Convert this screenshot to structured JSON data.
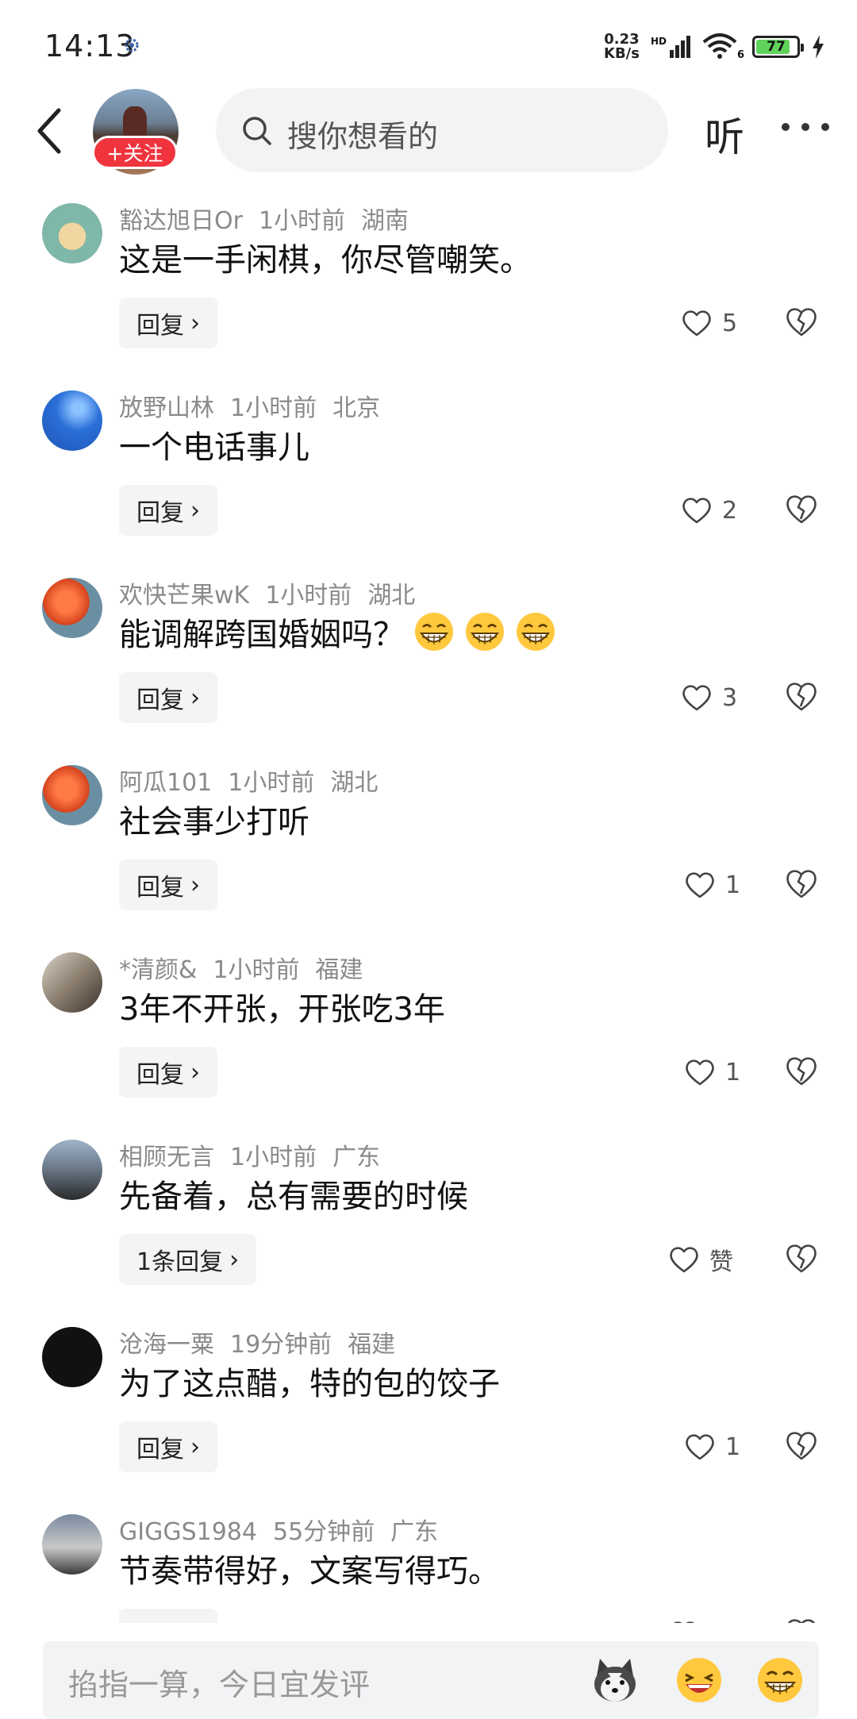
{
  "status_bar": {
    "time": "14:13",
    "speed_value": "0.23",
    "speed_unit": "KB/s",
    "hd": "HD",
    "wifi_gen": "6",
    "battery": "77"
  },
  "top_bar": {
    "follow_label": "+关注",
    "search_placeholder": "搜你想看的",
    "listen_label": "听"
  },
  "comments": [
    {
      "user": "豁达旭日Or",
      "time": "1小时前",
      "location": "湖南",
      "text": "这是一手闲棋，你尽管嘲笑。",
      "reply_label": "回复",
      "likes": "5",
      "emoji_count": 0
    },
    {
      "user": "放野山林",
      "time": "1小时前",
      "location": "北京",
      "text": "一个电话事儿",
      "reply_label": "回复",
      "likes": "2",
      "emoji_count": 0
    },
    {
      "user": "欢快芒果wK",
      "time": "1小时前",
      "location": "湖北",
      "text": "能调解跨国婚姻吗？",
      "reply_label": "回复",
      "likes": "3",
      "emoji_count": 3
    },
    {
      "user": "阿瓜101",
      "time": "1小时前",
      "location": "湖北",
      "text": "社会事少打听",
      "reply_label": "回复",
      "likes": "1",
      "emoji_count": 0
    },
    {
      "user": "*清颜&",
      "time": "1小时前",
      "location": "福建",
      "text": "3年不开张，开张吃3年",
      "reply_label": "回复",
      "likes": "1",
      "emoji_count": 0
    },
    {
      "user": "相顾无言",
      "time": "1小时前",
      "location": "广东",
      "text": "先备着，总有需要的时候",
      "reply_label": "1条回复",
      "likes": "赞",
      "emoji_count": 0
    },
    {
      "user": "沧海一粟",
      "time": "19分钟前",
      "location": "福建",
      "text": "为了这点醋，特的包的饺子",
      "reply_label": "回复",
      "likes": "1",
      "emoji_count": 0
    },
    {
      "user": "GIGGS1984",
      "time": "55分钟前",
      "location": "广东",
      "text": "节奏带得好，文案写得巧。",
      "reply_label": "回复",
      "likes": "赞",
      "emoji_count": 0
    }
  ],
  "bottom_bar": {
    "placeholder": "掐指一算，今日宜发评",
    "emojis": [
      "husky-emoji",
      "laughing-emoji",
      "grinning-emoji"
    ]
  }
}
